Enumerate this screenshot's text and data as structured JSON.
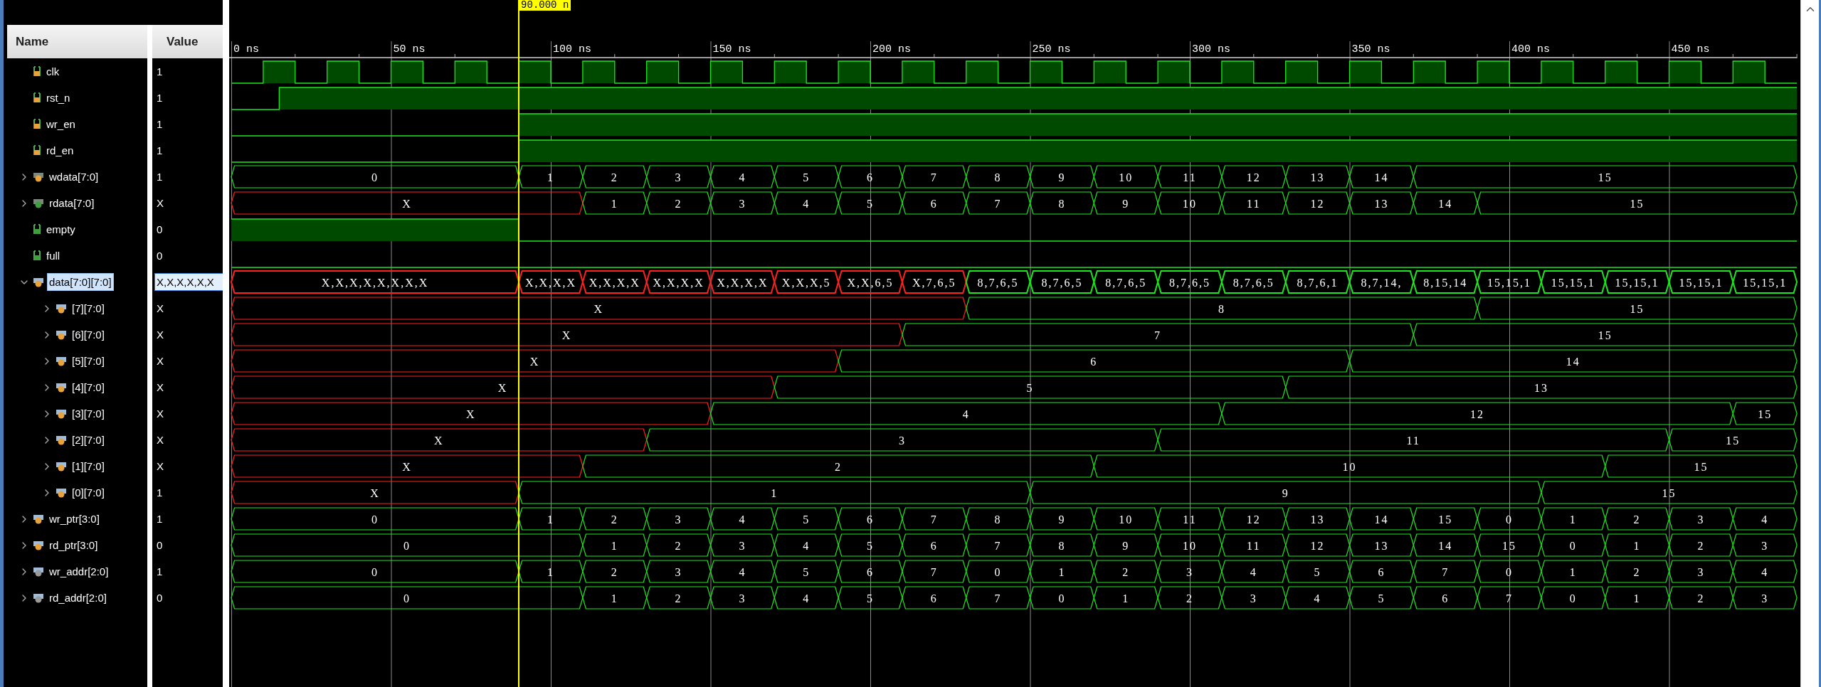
{
  "headers": {
    "name": "Name",
    "value": "Value"
  },
  "cursor": {
    "label": "90.000 n"
  },
  "time_axis": [
    "0 ns",
    "50 ns",
    "100 ns",
    "150 ns",
    "200 ns",
    "250 ns",
    "300 ns",
    "350 ns",
    "400 ns",
    "450 ns"
  ],
  "signals": [
    {
      "name": "clk",
      "value": "1",
      "kind": "bit",
      "selected": false
    },
    {
      "name": "rst_n",
      "value": "1",
      "kind": "bit",
      "selected": false
    },
    {
      "name": "wr_en",
      "value": "1",
      "kind": "bit",
      "selected": false
    },
    {
      "name": "rd_en",
      "value": "1",
      "kind": "bit",
      "selected": false
    },
    {
      "name": "wdata[7:0]",
      "value": "1",
      "kind": "bus",
      "selected": false,
      "expanded": false,
      "segments": [
        {
          "label": "0",
          "unknown": false
        },
        {
          "label": "1",
          "unknown": false
        },
        {
          "label": "2",
          "unknown": false
        },
        {
          "label": "3",
          "unknown": false
        },
        {
          "label": "4",
          "unknown": false
        },
        {
          "label": "5",
          "unknown": false
        },
        {
          "label": "6",
          "unknown": false
        },
        {
          "label": "7",
          "unknown": false
        },
        {
          "label": "8",
          "unknown": false
        },
        {
          "label": "9",
          "unknown": false
        },
        {
          "label": "10",
          "unknown": false
        },
        {
          "label": "11",
          "unknown": false
        },
        {
          "label": "12",
          "unknown": false
        },
        {
          "label": "13",
          "unknown": false
        },
        {
          "label": "14",
          "unknown": false
        },
        {
          "label": "15",
          "unknown": false
        }
      ]
    },
    {
      "name": "rdata[7:0]",
      "value": "X",
      "kind": "bus",
      "selected": false,
      "expanded": false,
      "segments": [
        {
          "label": "X",
          "unknown": true
        },
        {
          "label": "1",
          "unknown": false
        },
        {
          "label": "2",
          "unknown": false
        },
        {
          "label": "3",
          "unknown": false
        },
        {
          "label": "4",
          "unknown": false
        },
        {
          "label": "5",
          "unknown": false
        },
        {
          "label": "6",
          "unknown": false
        },
        {
          "label": "7",
          "unknown": false
        },
        {
          "label": "8",
          "unknown": false
        },
        {
          "label": "9",
          "unknown": false
        },
        {
          "label": "10",
          "unknown": false
        },
        {
          "label": "11",
          "unknown": false
        },
        {
          "label": "12",
          "unknown": false
        },
        {
          "label": "13",
          "unknown": false
        },
        {
          "label": "14",
          "unknown": false
        },
        {
          "label": "15",
          "unknown": false
        }
      ]
    },
    {
      "name": "empty",
      "value": "0",
      "kind": "bit",
      "selected": false
    },
    {
      "name": "full",
      "value": "0",
      "kind": "bit",
      "selected": false
    },
    {
      "name": "data[7:0][7:0]",
      "value": "X,X,X,X,X,X",
      "kind": "bus",
      "selected": true,
      "expanded": true,
      "segments": [
        {
          "label": "X,X,X,X,X,X,X,X",
          "unknown": true
        },
        {
          "label": "X,X,X,X",
          "unknown": true
        },
        {
          "label": "X,X,X,X",
          "unknown": true
        },
        {
          "label": "X,X,X,X",
          "unknown": true
        },
        {
          "label": "X,X,X,X",
          "unknown": true
        },
        {
          "label": "X,X,X,5",
          "unknown": true
        },
        {
          "label": "X,X,6,5",
          "unknown": true
        },
        {
          "label": "X,7,6,5",
          "unknown": true
        },
        {
          "label": "8,7,6,5",
          "unknown": false
        },
        {
          "label": "8,7,6,5",
          "unknown": false
        },
        {
          "label": "8,7,6,5",
          "unknown": false
        },
        {
          "label": "8,7,6,5",
          "unknown": false
        },
        {
          "label": "8,7,6,5",
          "unknown": false
        },
        {
          "label": "8,7,6,1",
          "unknown": false
        },
        {
          "label": "8,7,14,",
          "unknown": false
        },
        {
          "label": "8,15,14",
          "unknown": false
        },
        {
          "label": "15,15,1",
          "unknown": false
        },
        {
          "label": "15,15,1",
          "unknown": false
        },
        {
          "label": "15,15,1",
          "unknown": false
        },
        {
          "label": "15,15,1",
          "unknown": false
        },
        {
          "label": "15,15,1",
          "unknown": false
        }
      ],
      "children": [
        {
          "name": "[7][7:0]",
          "value": "X",
          "kind": "bus",
          "selected": false,
          "expanded": false,
          "segments": [
            {
              "label": "X",
              "unknown": true
            },
            {
              "label": "8",
              "unknown": false
            },
            {
              "label": "15",
              "unknown": false
            }
          ]
        },
        {
          "name": "[6][7:0]",
          "value": "X",
          "kind": "bus",
          "selected": false,
          "expanded": false,
          "segments": [
            {
              "label": "X",
              "unknown": true
            },
            {
              "label": "7",
              "unknown": false
            },
            {
              "label": "15",
              "unknown": false
            }
          ]
        },
        {
          "name": "[5][7:0]",
          "value": "X",
          "kind": "bus",
          "selected": false,
          "expanded": false,
          "segments": [
            {
              "label": "X",
              "unknown": true
            },
            {
              "label": "6",
              "unknown": false
            },
            {
              "label": "14",
              "unknown": false
            }
          ]
        },
        {
          "name": "[4][7:0]",
          "value": "X",
          "kind": "bus",
          "selected": false,
          "expanded": false,
          "segments": [
            {
              "label": "X",
              "unknown": true
            },
            {
              "label": "5",
              "unknown": false
            },
            {
              "label": "13",
              "unknown": false
            }
          ]
        },
        {
          "name": "[3][7:0]",
          "value": "X",
          "kind": "bus",
          "selected": false,
          "expanded": false,
          "segments": [
            {
              "label": "X",
              "unknown": true
            },
            {
              "label": "4",
              "unknown": false
            },
            {
              "label": "12",
              "unknown": false
            },
            {
              "label": "15",
              "unknown": false
            }
          ]
        },
        {
          "name": "[2][7:0]",
          "value": "X",
          "kind": "bus",
          "selected": false,
          "expanded": false,
          "segments": [
            {
              "label": "X",
              "unknown": true
            },
            {
              "label": "3",
              "unknown": false
            },
            {
              "label": "11",
              "unknown": false
            },
            {
              "label": "15",
              "unknown": false
            }
          ]
        },
        {
          "name": "[1][7:0]",
          "value": "X",
          "kind": "bus",
          "selected": false,
          "expanded": false,
          "segments": [
            {
              "label": "X",
              "unknown": true
            },
            {
              "label": "2",
              "unknown": false
            },
            {
              "label": "10",
              "unknown": false
            },
            {
              "label": "15",
              "unknown": false
            }
          ]
        },
        {
          "name": "[0][7:0]",
          "value": "1",
          "kind": "bus",
          "selected": false,
          "expanded": false,
          "segments": [
            {
              "label": "X",
              "unknown": true
            },
            {
              "label": "1",
              "unknown": false
            },
            {
              "label": "9",
              "unknown": false
            },
            {
              "label": "15",
              "unknown": false
            }
          ]
        }
      ]
    },
    {
      "name": "wr_ptr[3:0]",
      "value": "1",
      "kind": "bus",
      "selected": false,
      "expanded": false,
      "segments": [
        {
          "label": "0",
          "unknown": false
        },
        {
          "label": "1",
          "unknown": false
        },
        {
          "label": "2",
          "unknown": false
        },
        {
          "label": "3",
          "unknown": false
        },
        {
          "label": "4",
          "unknown": false
        },
        {
          "label": "5",
          "unknown": false
        },
        {
          "label": "6",
          "unknown": false
        },
        {
          "label": "7",
          "unknown": false
        },
        {
          "label": "8",
          "unknown": false
        },
        {
          "label": "9",
          "unknown": false
        },
        {
          "label": "10",
          "unknown": false
        },
        {
          "label": "11",
          "unknown": false
        },
        {
          "label": "12",
          "unknown": false
        },
        {
          "label": "13",
          "unknown": false
        },
        {
          "label": "14",
          "unknown": false
        },
        {
          "label": "15",
          "unknown": false
        },
        {
          "label": "0",
          "unknown": false
        },
        {
          "label": "1",
          "unknown": false
        },
        {
          "label": "2",
          "unknown": false
        },
        {
          "label": "3",
          "unknown": false
        },
        {
          "label": "4",
          "unknown": false
        }
      ]
    },
    {
      "name": "rd_ptr[3:0]",
      "value": "0",
      "kind": "bus",
      "selected": false,
      "expanded": false,
      "segments": [
        {
          "label": "0",
          "unknown": false
        },
        {
          "label": "1",
          "unknown": false
        },
        {
          "label": "2",
          "unknown": false
        },
        {
          "label": "3",
          "unknown": false
        },
        {
          "label": "4",
          "unknown": false
        },
        {
          "label": "5",
          "unknown": false
        },
        {
          "label": "6",
          "unknown": false
        },
        {
          "label": "7",
          "unknown": false
        },
        {
          "label": "8",
          "unknown": false
        },
        {
          "label": "9",
          "unknown": false
        },
        {
          "label": "10",
          "unknown": false
        },
        {
          "label": "11",
          "unknown": false
        },
        {
          "label": "12",
          "unknown": false
        },
        {
          "label": "13",
          "unknown": false
        },
        {
          "label": "14",
          "unknown": false
        },
        {
          "label": "15",
          "unknown": false
        },
        {
          "label": "0",
          "unknown": false
        },
        {
          "label": "1",
          "unknown": false
        },
        {
          "label": "2",
          "unknown": false
        },
        {
          "label": "3",
          "unknown": false
        }
      ]
    },
    {
      "name": "wr_addr[2:0]",
      "value": "1",
      "kind": "bus",
      "selected": false,
      "expanded": false,
      "segments": [
        {
          "label": "0",
          "unknown": false
        },
        {
          "label": "1",
          "unknown": false
        },
        {
          "label": "2",
          "unknown": false
        },
        {
          "label": "3",
          "unknown": false
        },
        {
          "label": "4",
          "unknown": false
        },
        {
          "label": "5",
          "unknown": false
        },
        {
          "label": "6",
          "unknown": false
        },
        {
          "label": "7",
          "unknown": false
        },
        {
          "label": "0",
          "unknown": false
        },
        {
          "label": "1",
          "unknown": false
        },
        {
          "label": "2",
          "unknown": false
        },
        {
          "label": "3",
          "unknown": false
        },
        {
          "label": "4",
          "unknown": false
        },
        {
          "label": "5",
          "unknown": false
        },
        {
          "label": "6",
          "unknown": false
        },
        {
          "label": "7",
          "unknown": false
        },
        {
          "label": "0",
          "unknown": false
        },
        {
          "label": "1",
          "unknown": false
        },
        {
          "label": "2",
          "unknown": false
        },
        {
          "label": "3",
          "unknown": false
        },
        {
          "label": "4",
          "unknown": false
        }
      ]
    },
    {
      "name": "rd_addr[2:0]",
      "value": "0",
      "kind": "bus",
      "selected": false,
      "expanded": false,
      "segments": [
        {
          "label": "0",
          "unknown": false
        },
        {
          "label": "1",
          "unknown": false
        },
        {
          "label": "2",
          "unknown": false
        },
        {
          "label": "3",
          "unknown": false
        },
        {
          "label": "4",
          "unknown": false
        },
        {
          "label": "5",
          "unknown": false
        },
        {
          "label": "6",
          "unknown": false
        },
        {
          "label": "7",
          "unknown": false
        },
        {
          "label": "0",
          "unknown": false
        },
        {
          "label": "1",
          "unknown": false
        },
        {
          "label": "2",
          "unknown": false
        },
        {
          "label": "3",
          "unknown": false
        },
        {
          "label": "4",
          "unknown": false
        },
        {
          "label": "5",
          "unknown": false
        },
        {
          "label": "6",
          "unknown": false
        },
        {
          "label": "7",
          "unknown": false
        },
        {
          "label": "0",
          "unknown": false
        },
        {
          "label": "1",
          "unknown": false
        },
        {
          "label": "2",
          "unknown": false
        },
        {
          "label": "3",
          "unknown": false
        }
      ]
    }
  ]
}
